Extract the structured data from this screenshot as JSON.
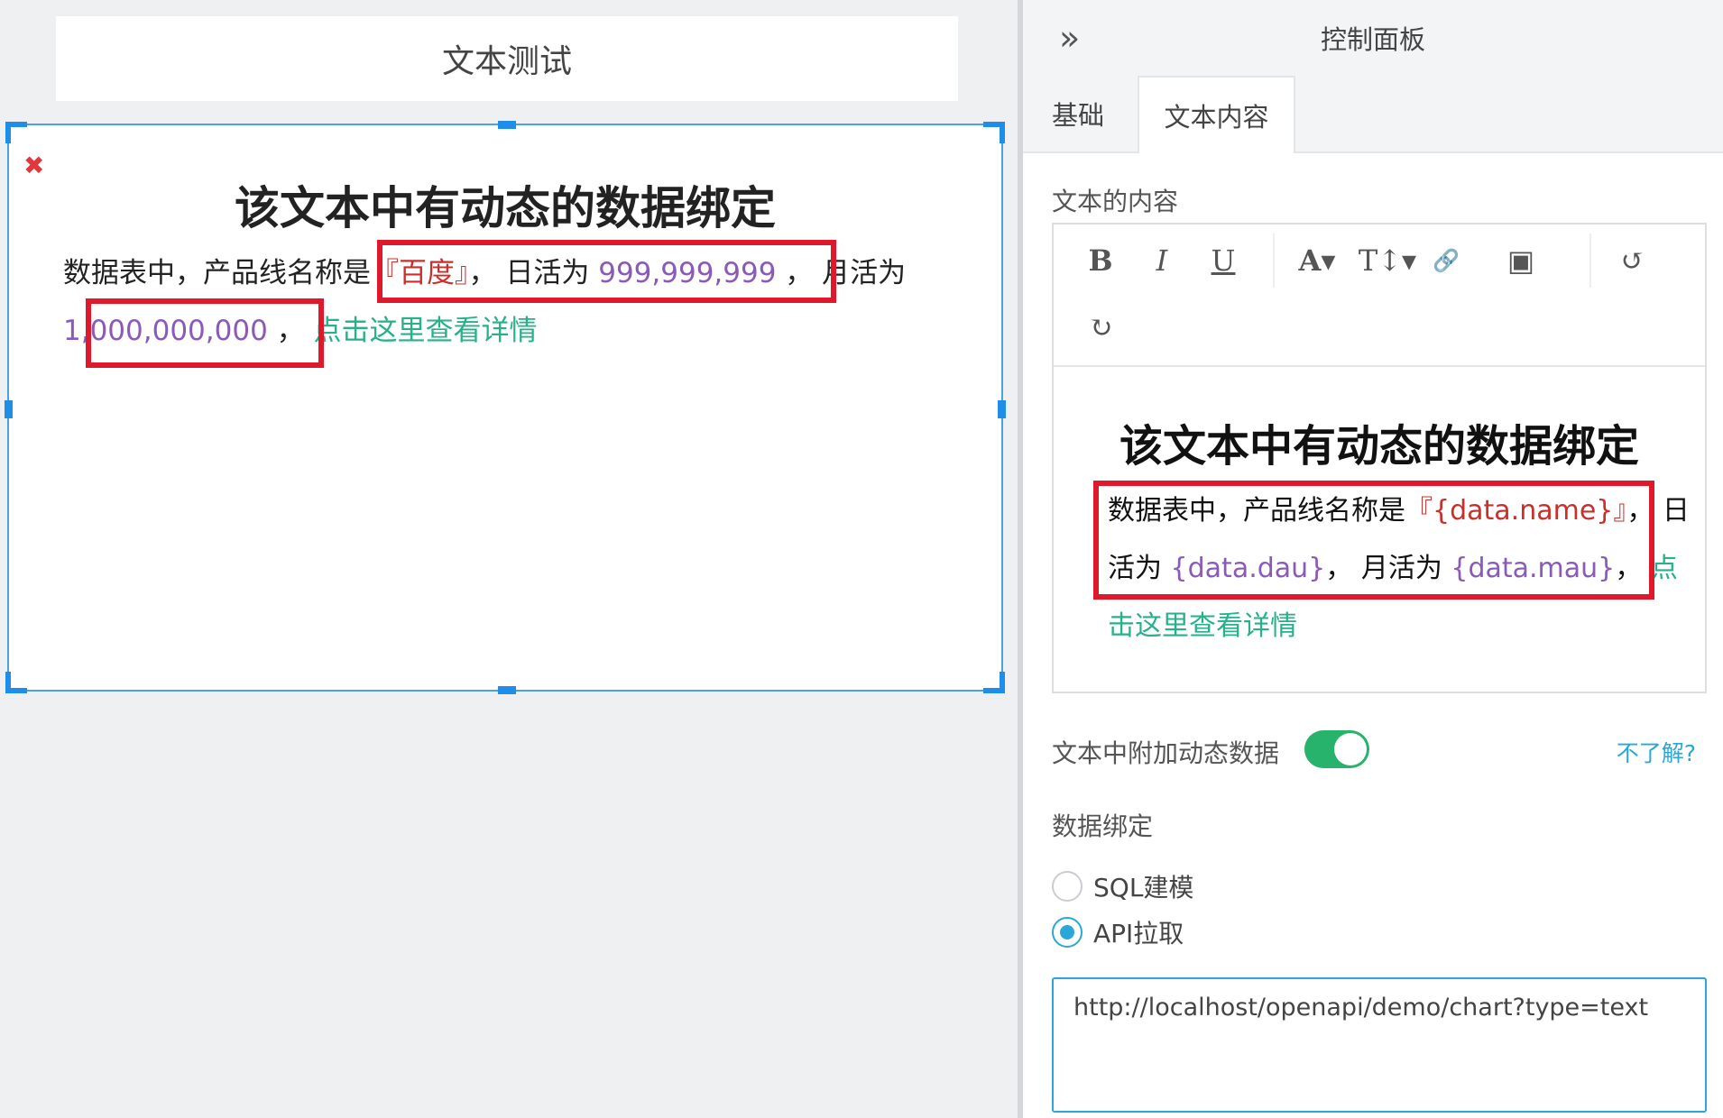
{
  "canvas": {
    "title": "文本测试",
    "widget": {
      "heading": "该文本中有动态的数据绑定",
      "para_prefix": "数据表中，产品线名称是",
      "name_value": "『百度』",
      "sep1": "，",
      "dau_prefix": " 日活为 ",
      "dau_value": "999,999,999",
      "sep2": " ，",
      "mau_prefix": "月活为",
      "mau_value": "1,000,000,000",
      "sep3": " ，",
      "link": "点击这里查看详情"
    }
  },
  "panel": {
    "title": "控制面板",
    "collapse_icon": "»",
    "tabs": [
      {
        "label": "基础"
      },
      {
        "label": "文本内容"
      }
    ],
    "content_label": "文本的内容",
    "toolbar": {
      "bold": "B",
      "italic": "I",
      "underline": "U",
      "font_color": "A▾",
      "font_size": "T↕▾",
      "link_icon": "🔗",
      "image_icon": "▣",
      "undo_icon": "↺",
      "redo_icon": "↻"
    },
    "editor": {
      "heading": "该文本中有动态的数据绑定",
      "para_prefix": "数据表中，产品线名称是",
      "name_tpl": "『{data.name}』",
      "sep1": "，",
      "dau_prefix": "日活为 ",
      "dau_tpl": "{data.dau}",
      "sep2": "， 月活为 ",
      "mau_tpl": "{data.mau}",
      "sep3": "，",
      "link": "点击这里查看详情"
    },
    "toggle_label": "文本中附加动态数据",
    "toggle_on": true,
    "help_link": "不了解?",
    "binding_label": "数据绑定",
    "radio_options": [
      {
        "label": "SQL建模",
        "selected": false
      },
      {
        "label": "API拉取",
        "selected": true
      }
    ],
    "api_url": "http://localhost/openapi/demo/chart?type=text"
  },
  "colors": {
    "accent": "#2aa7d9",
    "selection": "#1e8ee8",
    "highlight": "#e0182b",
    "value_red": "#c8302c",
    "value_purple": "#8a5ab8",
    "link_green": "#26b08b",
    "toggle_green": "#27b36b"
  }
}
